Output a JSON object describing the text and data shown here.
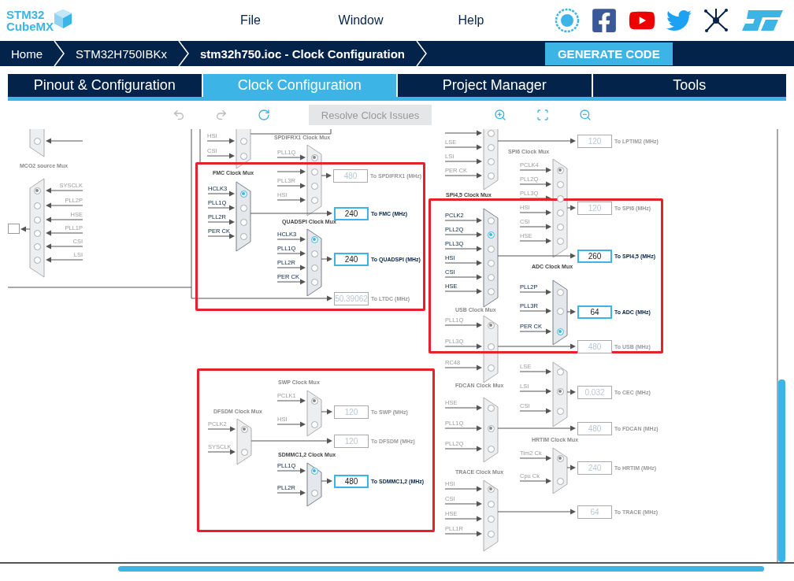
{
  "header": {
    "logo": {
      "line_1": "STM32",
      "line_2": "CubeMX"
    },
    "menu": [
      "File",
      "Window",
      "Help"
    ]
  },
  "breadcrumb": [
    {
      "label": "Home",
      "current": false
    },
    {
      "label": "STM32H750IBKx",
      "current": false
    },
    {
      "label": "stm32h750.ioc - Clock Configuration",
      "current": true
    }
  ],
  "generate_button": "GENERATE CODE",
  "tabs": [
    {
      "label": "Pinout & Configuration",
      "selected": false
    },
    {
      "label": "Clock Configuration",
      "selected": true
    },
    {
      "label": "Project Manager",
      "selected": false
    },
    {
      "label": "Tools",
      "selected": false
    }
  ],
  "toolbar": [
    {
      "kind": "undo",
      "disabled": true
    },
    {
      "kind": "redo",
      "disabled": true
    },
    {
      "kind": "reset",
      "disabled": false
    },
    {
      "kind": "resolve",
      "label": "Resolve Clock Issues",
      "disabled": true
    },
    {
      "kind": "zoom_in",
      "disabled": false
    },
    {
      "kind": "fit",
      "disabled": false
    },
    {
      "kind": "zoom_out",
      "disabled": false
    }
  ],
  "diagram": {
    "muxes": [
      {
        "active": false,
        "inputs": [
          {
            "selected": false
          }
        ]
      },
      {
        "title": "MCO2 source Mux",
        "active": false,
        "inputs": [
          {
            "label": "SYSCLK",
            "selected": true
          },
          {
            "label": "PLL2P",
            "selected": false
          },
          {
            "label": "HSE",
            "selected": false
          },
          {
            "label": "PLL1P",
            "selected": false
          },
          {
            "label": "CSI",
            "selected": false
          },
          {
            "label": "LSI",
            "selected": false
          }
        ],
        "output": {
          "kind": "dropdown"
        }
      },
      {
        "active": false,
        "inputs": [
          {
            "label": "HSI",
            "selected": false
          },
          {
            "label": "CSI",
            "selected": false
          }
        ]
      },
      {
        "title": "SPDIFRX1 Clock Mux",
        "active": false,
        "inputs": [
          {
            "label": "PLL1Q",
            "selected": true
          },
          {
            "selected": false
          },
          {
            "label": "PLL3R",
            "selected": false
          },
          {
            "label": "HSI",
            "selected": false
          }
        ],
        "output": {
          "kind": "box",
          "value": "480",
          "label": "To SPDIFRX1 (MHz)"
        }
      },
      {
        "title": "FMC Clock Mux",
        "active": true,
        "inputs": [
          {
            "label": "HCLK3",
            "selected": true
          },
          {
            "label": "PLL1Q",
            "selected": false
          },
          {
            "label": "PLL2R",
            "selected": false
          },
          {
            "label": "PER CK",
            "selected": false
          }
        ],
        "output": {
          "kind": "box",
          "value": "240",
          "label": "To FMC (MHz)"
        }
      },
      {
        "title": "QUADSPI Clock Mux",
        "active": true,
        "inputs": [
          {
            "label": "HCLK3",
            "selected": true
          },
          {
            "label": "PLL1Q",
            "selected": false
          },
          {
            "label": "PLL2R",
            "selected": false
          },
          {
            "label": "PER CK",
            "selected": false
          }
        ],
        "output": {
          "kind": "box",
          "value": "240",
          "label": "To QUADSPI (MHz)"
        }
      },
      {
        "active": false,
        "inputs": [
          {
            "selected": false
          },
          {
            "label": "LSE",
            "selected": false
          },
          {
            "label": "LSI",
            "selected": false
          },
          {
            "label": "PER CK",
            "selected": false
          }
        ],
        "output": {
          "kind": "box",
          "value": "120",
          "label": "To LPTIM2 (MHz)"
        }
      },
      {
        "title": "SPI6 Clock Mux",
        "active": false,
        "inputs": [
          {
            "label": "PCLK4",
            "selected": true
          },
          {
            "label": "PLL2Q",
            "selected": false
          },
          {
            "label": "PLL3Q",
            "selected": false
          },
          {
            "label": "HSI",
            "selected": false
          },
          {
            "label": "CSI",
            "selected": false
          },
          {
            "label": "HSE",
            "selected": false
          }
        ],
        "output": {
          "kind": "box",
          "value": "120",
          "label": "To SPI6 (MHz)"
        }
      },
      {
        "title": "SPI4,5 Clock Mux",
        "active": true,
        "inputs": [
          {
            "label": "PCLK2",
            "selected": false
          },
          {
            "label": "PLL2Q",
            "selected": true
          },
          {
            "label": "PLL3Q",
            "selected": false
          },
          {
            "label": "HSI",
            "selected": false
          },
          {
            "label": "CSI",
            "selected": false
          },
          {
            "label": "HSE",
            "selected": false
          }
        ],
        "output": {
          "kind": "box",
          "value": "260",
          "label": "To SPI4,5 (MHz)"
        }
      },
      {
        "title": "ADC Clock Mux",
        "active": true,
        "inputs": [
          {
            "label": "PLL2P",
            "selected": false
          },
          {
            "label": "PLL3R",
            "selected": false
          },
          {
            "label": "PER CK",
            "selected": true
          }
        ],
        "output": {
          "kind": "box",
          "value": "64",
          "label": "To ADC (MHz)"
        }
      },
      {
        "title": "USB Clock Mux",
        "active": false,
        "inputs": [
          {
            "label": "PLL1Q",
            "selected": true
          },
          {
            "label": "PLL3Q",
            "selected": false
          },
          {
            "label": "RC48",
            "selected": false
          }
        ],
        "output": {
          "kind": "box",
          "value": "480",
          "label": "To USB (MHz)"
        }
      },
      {
        "active": false,
        "inputs": [
          {
            "label": "LSE",
            "selected": false
          },
          {
            "label": "LSI",
            "selected": true
          },
          {
            "label": "CSI",
            "selected": false
          }
        ],
        "output": {
          "kind": "box",
          "value": "0.032",
          "label": "To CEC (MHz)"
        }
      },
      {
        "title": "FDCAN Clock Mux",
        "active": false,
        "inputs": [
          {
            "label": "HSE",
            "selected": false
          },
          {
            "label": "PLL1Q",
            "selected": true
          },
          {
            "label": "PLL2Q",
            "selected": false
          }
        ],
        "output": {
          "kind": "box",
          "value": "480",
          "label": "To FDCAN (MHz)"
        }
      },
      {
        "title": "HRTIM Clock Mux",
        "active": false,
        "inputs": [
          {
            "label": "Tim2 Ck",
            "selected": true
          },
          {
            "label": "Cpu Ck",
            "selected": false
          }
        ],
        "output": {
          "kind": "box",
          "value": "240",
          "label": "To HRTIM (MHz)"
        }
      },
      {
        "title": "TRACE Clock Mux",
        "active": false,
        "inputs": [
          {
            "label": "HSI",
            "selected": true
          },
          {
            "label": "CSI",
            "selected": false
          },
          {
            "label": "HSE",
            "selected": false
          },
          {
            "label": "PLL1R",
            "selected": false
          }
        ],
        "output": {
          "kind": "box",
          "value": "64",
          "label": "To TRACE (MHz)"
        }
      },
      {
        "title": "SWP Clock Mux",
        "active": false,
        "inputs": [
          {
            "label": "PCLK1",
            "selected": true
          },
          {
            "label": "HSI",
            "selected": false
          }
        ],
        "output": {
          "kind": "box",
          "value": "120",
          "label": "To SWP (MHz)"
        }
      },
      {
        "title": "DFSDM Clock Mux",
        "active": false,
        "inputs": [
          {
            "label": "PCLK2",
            "selected": true
          },
          {
            "label": "SYSCLK",
            "selected": false
          }
        ],
        "output": {
          "kind": "box",
          "value": "120",
          "label": "To DFSDM (MHz)"
        }
      },
      {
        "title": "SDMMC1,2 Clock Mux",
        "active": true,
        "inputs": [
          {
            "label": "PLL1Q",
            "selected": true
          },
          {
            "label": "PLL2R",
            "selected": false
          }
        ],
        "output": {
          "kind": "box",
          "value": "480",
          "label": "To SDMMC1,2 (MHz)"
        }
      }
    ],
    "outputs": [
      {
        "value": "50.39062",
        "label": "To LTDC (MHz)",
        "active": false
      }
    ]
  }
}
